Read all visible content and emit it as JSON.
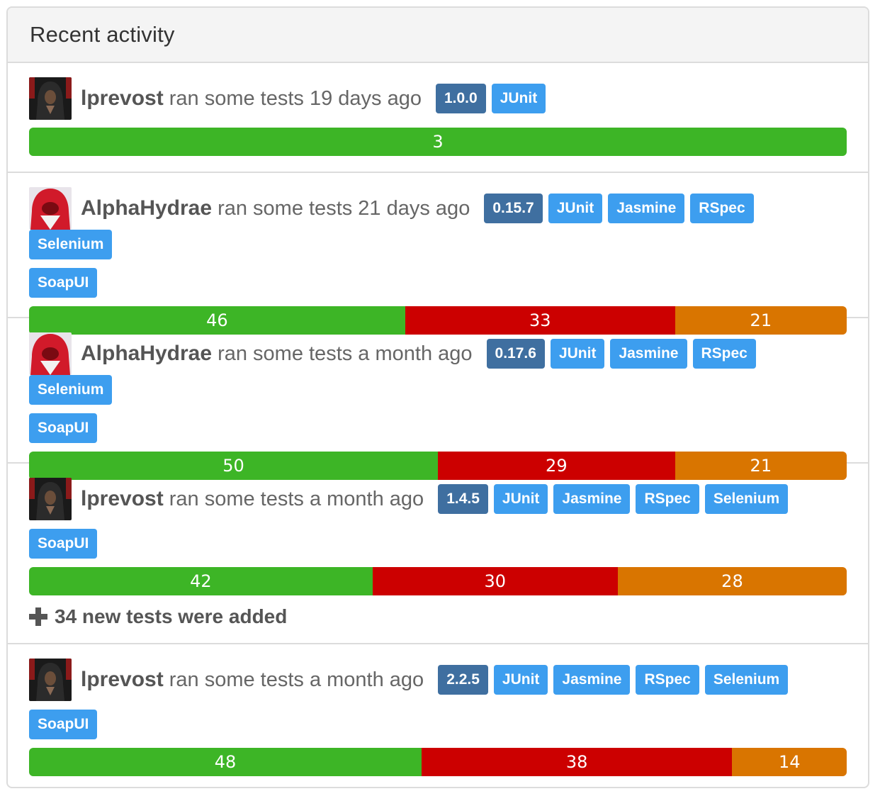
{
  "panel": {
    "title": "Recent activity"
  },
  "legend_colors": {
    "passed": "#3db526",
    "failed": "#cc0000",
    "skipped": "#d97500"
  },
  "activities": [
    {
      "user": "lprevost",
      "avatar_icon": "dark-hooded-figure-avatar",
      "action": "ran some tests 19 days ago",
      "version": "1.0.0",
      "tags": [
        "JUnit"
      ],
      "results": {
        "passed": 3,
        "failed": null,
        "skipped": null
      }
    },
    {
      "user": "AlphaHydrae",
      "avatar_icon": "red-hooded-figure-avatar",
      "action": "ran some tests 21 days ago",
      "version": "0.15.7",
      "tags": [
        "JUnit",
        "Jasmine",
        "RSpec",
        "Selenium",
        "SoapUI"
      ],
      "results": {
        "passed": 46,
        "failed": 33,
        "skipped": 21
      }
    },
    {
      "user": "AlphaHydrae",
      "avatar_icon": "red-hooded-figure-avatar",
      "action": "ran some tests a month ago",
      "version": "0.17.6",
      "tags": [
        "JUnit",
        "Jasmine",
        "RSpec",
        "Selenium",
        "SoapUI"
      ],
      "results": {
        "passed": 50,
        "failed": 29,
        "skipped": 21
      }
    },
    {
      "user": "lprevost",
      "avatar_icon": "dark-hooded-figure-avatar",
      "action": "ran some tests a month ago",
      "version": "1.4.5",
      "tags": [
        "JUnit",
        "Jasmine",
        "RSpec",
        "Selenium",
        "SoapUI"
      ],
      "results": {
        "passed": 42,
        "failed": 30,
        "skipped": 28
      },
      "note": "34 new tests were added"
    },
    {
      "user": "lprevost",
      "avatar_icon": "dark-hooded-figure-avatar",
      "action": "ran some tests a month ago",
      "version": "2.2.5",
      "tags": [
        "JUnit",
        "Jasmine",
        "RSpec",
        "Selenium",
        "SoapUI"
      ],
      "results": {
        "passed": 48,
        "failed": 38,
        "skipped": 14
      }
    }
  ]
}
